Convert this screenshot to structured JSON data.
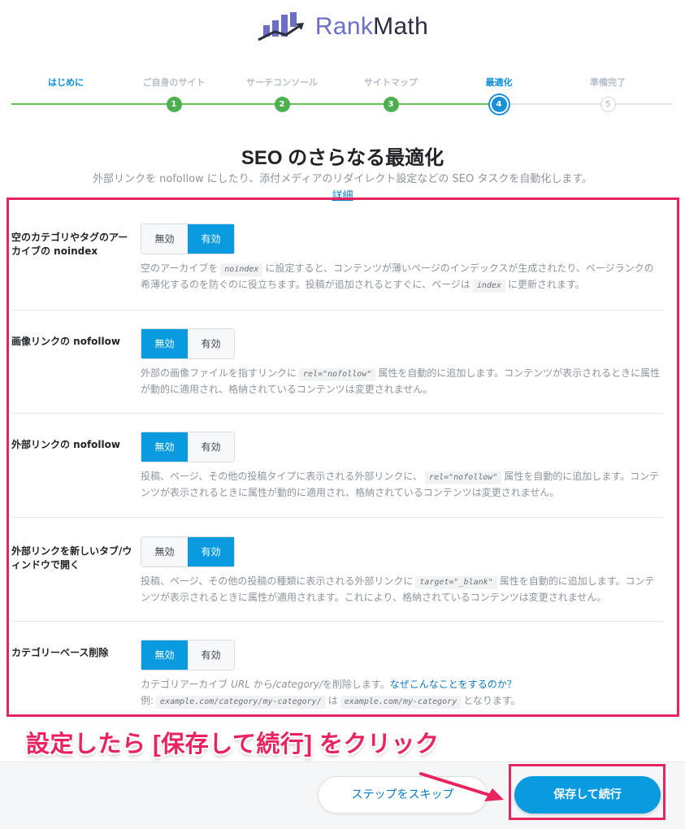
{
  "logo": {
    "rank": "Rank",
    "math": "Math",
    "colors": {
      "rank": "#6a6fc5",
      "math": "#2c2e3f",
      "mark": "#6a6fc5"
    }
  },
  "steps": [
    {
      "label": "はじめに",
      "number": "",
      "status": "first"
    },
    {
      "label": "ご自身のサイト",
      "number": "1",
      "status": "done"
    },
    {
      "label": "サーチコンソール",
      "number": "2",
      "status": "done"
    },
    {
      "label": "サイトマップ",
      "number": "3",
      "status": "done"
    },
    {
      "label": "最適化",
      "number": "4",
      "status": "active"
    },
    {
      "label": "準備完了",
      "number": "5",
      "status": "todo"
    }
  ],
  "header": {
    "title": "SEO のさらなる最適化",
    "subtitle": "外部リンクを nofollow にしたり、添付メディアのリダイレクト設定などの SEO タスクを自動化します。",
    "details_link": "詳細"
  },
  "toggle_labels": {
    "off": "無効",
    "on": "有効"
  },
  "settings": [
    {
      "label": "空のカテゴリやタグのアーカイブの noindex",
      "value": "on",
      "desc": {
        "t1": "空のアーカイブを",
        "c1": "noindex",
        "t2": "に設定すると、コンテンツが薄いページのインデックスが生成されたり、ページランクの希薄化するのを防ぐのに役立ちます。投稿が追加されるとすぐに、ページは",
        "c2": "index",
        "t3": "に更新されます。"
      }
    },
    {
      "label": "画像リンクの nofollow",
      "value": "off",
      "desc": {
        "t1": "外部の画像ファイルを指すリンクに",
        "c1": "rel=\"nofollow\"",
        "t2": "属性を自動的に追加します。コンテンツが表示されるときに属性が動的に適用され、格納されているコンテンツは変更されません。"
      }
    },
    {
      "label": "外部リンクの nofollow",
      "value": "off",
      "desc": {
        "t1": "投稿、ページ、その他の投稿タイプに表示される外部リンクに、",
        "c1": "rel=\"nofollow\"",
        "t2": "属性を自動的に追加します。コンテンツが表示されるときに属性が動的に適用され、格納されているコンテンツは変更されません。"
      }
    },
    {
      "label": "外部リンクを新しいタブ/ウィンドウで開く",
      "value": "on",
      "desc": {
        "t1": "投稿、ページ、その他の投稿の種類に表示される外部リンクに",
        "c1": "target=\"_blank\"",
        "t2": "属性を自動的に追加します。コンテンツが表示されるときに属性が適用されます。これにより、格納されているコンテンツは変更されません。"
      }
    },
    {
      "label": "カテゴリーベース削除",
      "value": "off",
      "desc": {
        "t1": "カテゴリアーカイブ",
        "i1": "URL",
        "t2": "から",
        "i2": "/category/",
        "t3": "を削除します。",
        "link": "なぜこんなことをするのか？",
        "example_prefix": "例:",
        "c1": "example.com/category/my-category/",
        "t4": "は",
        "c2": "example.com/my-category",
        "t5": "となります。"
      }
    }
  ],
  "annotation": "設定したら [保存して続行] をクリック",
  "footer": {
    "skip_label": "ステップをスキップ",
    "save_label": "保存して続行"
  },
  "colors": {
    "accent": "#0a9ae0",
    "highlight": "#e8245f",
    "progress": "#4cb04f"
  }
}
